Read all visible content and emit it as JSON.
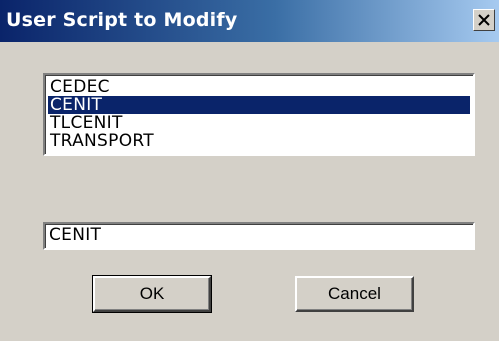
{
  "window": {
    "title": "User Script to Modify",
    "close_glyph": "✕"
  },
  "list": {
    "items": [
      "CEDEC",
      "CENIT",
      "TLCENIT",
      "TRANSPORT"
    ],
    "selected_index": 1
  },
  "input": {
    "value": "CENIT"
  },
  "buttons": {
    "ok_label": "OK",
    "cancel_label": "Cancel"
  },
  "colors": {
    "dialog_bg": "#d4d0c8",
    "titlebar_start": "#0a246a",
    "titlebar_end": "#a6caf0",
    "selection": "#0a246a"
  },
  "icons": {
    "close": "close-icon"
  }
}
